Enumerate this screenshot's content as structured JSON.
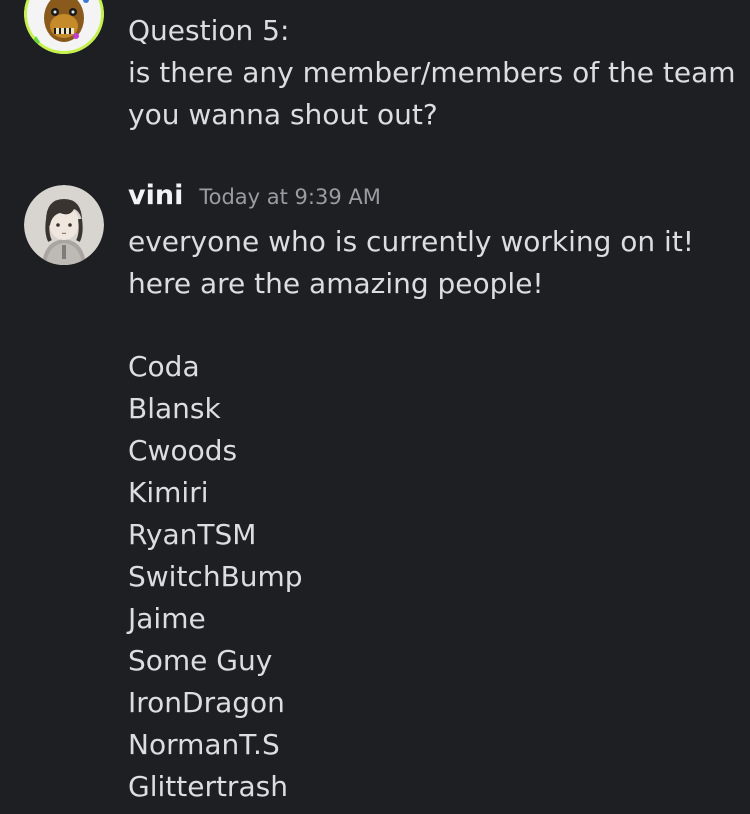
{
  "messages": [
    {
      "author": "",
      "timestamp": "",
      "lines": [
        "Question 5:",
        "is there any member/members of the team",
        "you wanna shout out?"
      ]
    },
    {
      "author": "vini",
      "timestamp": "Today at 9:39 AM",
      "lines": [
        "everyone who is currently working on it!",
        "here are the amazing people!"
      ],
      "members": [
        "Coda",
        "Blansk",
        "Cwoods",
        "Kimiri",
        "RyanTSM",
        "SwitchBump",
        "Jaime",
        "Some Guy",
        "IronDragon",
        "NormanT.S",
        "Glittertrash"
      ]
    }
  ],
  "icons": {
    "first_avatar": "animatronic-avatar-icon",
    "second_avatar": "vini-avatar-icon"
  },
  "colors": {
    "background": "#1e1f23",
    "text": "#dcdde1",
    "username": "#f2f3f5",
    "timestamp": "#9a9ca3",
    "avatar_ring": "#c6f04a"
  }
}
